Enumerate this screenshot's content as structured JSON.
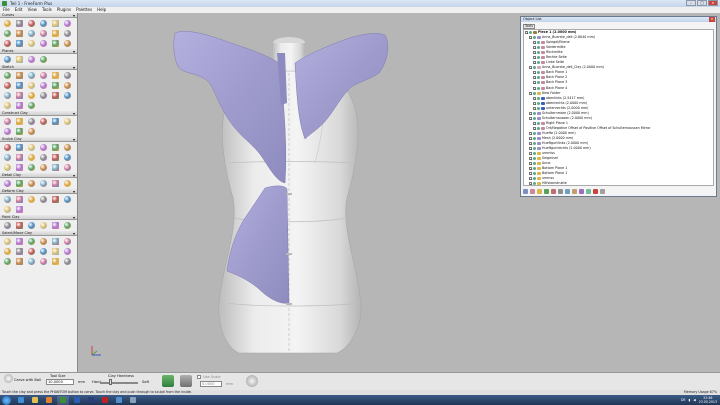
{
  "window": {
    "title": "Teil 1 - FreeForm Plus"
  },
  "menu": [
    "File",
    "Edit",
    "View",
    "Tools",
    "Plugins",
    "Palettes",
    "Help"
  ],
  "palettes": [
    {
      "name": "Curves",
      "icons": [
        "curve-select-icon",
        "curve-draw-icon",
        "curve-sphere-icon",
        "curve-edit-icon",
        "curve-path-icon",
        "curve-wave-icon",
        "curve-point-icon",
        "curve-blob-icon",
        "curve-twist-icon",
        "curve-loop-icon",
        "curve-line-icon",
        "curve-mesh-icon",
        "curve-tool-icon",
        "curve-bend-icon",
        "curve-ring-icon",
        "curve-cut-icon",
        "curve-knot-icon",
        "curve-arrow-icon"
      ]
    },
    {
      "name": "Planes",
      "icons": [
        "plane-icon",
        "plane-offset-icon",
        "plane-angle-icon",
        "plane-grid-icon"
      ]
    },
    {
      "name": "Sketch",
      "icons": [
        "sketch-select-icon",
        "sketch-line-icon",
        "sketch-pen-icon",
        "sketch-pencil-icon",
        "sketch-offset-icon",
        "sketch-mirror-icon",
        "sketch-curve-icon",
        "sketch-fillet-icon",
        "sketch-arc-icon",
        "sketch-trim-icon",
        "sketch-extend-icon",
        "sketch-circle-icon",
        "sketch-rect-icon",
        "sketch-spline-icon",
        "sketch-text-icon",
        "sketch-project-icon",
        "sketch-cut-icon",
        "sketch-grid-icon",
        "sketch-import-icon",
        "sketch-paint-icon",
        "sketch-delete-icon"
      ]
    },
    {
      "name": "Construct Clay",
      "icons": [
        "construct-extrude-icon",
        "construct-revolve-icon",
        "construct-loft-icon",
        "construct-sweep-icon",
        "construct-blob-icon",
        "construct-wrap-icon",
        "construct-box-icon",
        "construct-sphere-icon",
        "construct-cyl-icon"
      ]
    },
    {
      "name": "Sculpt Clay",
      "icons": [
        "sculpt-carve-icon",
        "sculpt-add-icon",
        "sculpt-smooth-icon",
        "sculpt-tug-icon",
        "sculpt-emboss-icon",
        "sculpt-flatten-icon",
        "sculpt-pinch-icon",
        "sculpt-groove-icon",
        "sculpt-stamp-icon",
        "sculpt-mirror-icon",
        "sculpt-fill-icon",
        "sculpt-shrink-icon",
        "sculpt-fillet-icon",
        "sculpt-smudge-icon",
        "sculpt-attract-icon",
        "sculpt-inflate-icon",
        "sculpt-bulge-icon",
        "sculpt-carve2-icon"
      ]
    },
    {
      "name": "Detail Clay",
      "icons": [
        "detail-emboss-icon",
        "detail-carve-icon",
        "detail-engrave-icon",
        "detail-smooth-icon",
        "detail-sharpen-icon",
        "detail-texture-icon"
      ]
    },
    {
      "name": "Deform Clay",
      "icons": [
        "deform-cage-icon",
        "deform-bend-icon",
        "deform-twist-icon",
        "deform-stretch-icon",
        "deform-warp-icon",
        "deform-tug-icon",
        "deform-pin-icon",
        "deform-scale-icon"
      ]
    },
    {
      "name": "Paint Clay",
      "icons": [
        "paint-brush-icon",
        "paint-fill-icon",
        "paint-spray-icon",
        "paint-eraser-icon",
        "paint-stamp-icon",
        "paint-picker-icon"
      ]
    },
    {
      "name": "Select/Move Clay",
      "icons": [
        "select-move-icon",
        "select-rotate-icon",
        "select-scale-icon",
        "select-mirror-icon",
        "select-copy-icon",
        "select-align-icon",
        "select-lasso-icon",
        "select-box-icon",
        "select-paint-icon",
        "select-invert-icon",
        "select-all-icon",
        "select-piece-icon",
        "select-layer-icon",
        "select-group-icon",
        "select-split-icon",
        "select-merge-icon",
        "select-boolean-icon",
        "select-cut-icon"
      ]
    }
  ],
  "object_list": {
    "title": "Object List",
    "tools_label": "Tools",
    "items": [
      {
        "label": "Piece 1 (2.0000 mm)",
        "level": 0,
        "bold": true,
        "color": "#9c7a3b"
      },
      {
        "label": "Anna_Buerste_dell (2.8040 mm)",
        "level": 1,
        "color": "#9b8bcf"
      },
      {
        "label": "Spiegel/Ebene",
        "level": 2,
        "color": "#c58aa0"
      },
      {
        "label": "Vordermitte",
        "level": 2,
        "color": "#c58aa0"
      },
      {
        "label": "Rückmitte",
        "level": 2,
        "color": "#c58aa0"
      },
      {
        "label": "Rechte Seite",
        "level": 2,
        "color": "#c58aa0"
      },
      {
        "label": "Linke Seite",
        "level": 2,
        "color": "#c58aa0"
      },
      {
        "label": "Anna_Buerste_dell_Clay (2.0000 mm)",
        "level": 1,
        "color": "#d3a3b3"
      },
      {
        "label": "Back Plane 1",
        "level": 2,
        "color": "#c58aa0"
      },
      {
        "label": "Back Plane 2",
        "level": 2,
        "color": "#c58aa0"
      },
      {
        "label": "Back Plane 3",
        "level": 2,
        "color": "#c58aa0"
      },
      {
        "label": "Back Plane 4",
        "level": 2,
        "color": "#c58aa0"
      },
      {
        "label": "New Folder",
        "level": 1,
        "color": "#d8b84a"
      },
      {
        "label": "obenlinks (2.5417 mm)",
        "level": 2,
        "color": "#3b5fb8"
      },
      {
        "label": "obenrechts (2.0000 mm)",
        "level": 2,
        "color": "#3b5fb8"
      },
      {
        "label": "untenrechts (2.0000 mm)",
        "level": 2,
        "color": "#3b5fb8"
      },
      {
        "label": "Schulternmam (2.0000 mm)",
        "level": 1,
        "color": "#9b8bcf"
      },
      {
        "label": "Schulternaussen (2.0000 mm)",
        "level": 1,
        "color": "#9b8bcf"
      },
      {
        "label": "Right Plane 1",
        "level": 2,
        "color": "#c58aa0"
      },
      {
        "label": "Ort/Negative Offset of Positive Offset of Schulternaussen Mirror",
        "level": 2,
        "color": "#c58aa0"
      },
      {
        "label": "Huefte (2.0000 mm)",
        "level": 1,
        "color": "#9b8bcf"
      },
      {
        "label": "Mesh (2.0000 mm)",
        "level": 1,
        "color": "#9b8bcf"
      },
      {
        "label": "Hueftgurtlinks (2.0000 mm)",
        "level": 1,
        "color": "#9b8bcf"
      },
      {
        "label": "Hueftgurtrechts (2.0000 mm)",
        "level": 1,
        "color": "#9b8bcf"
      },
      {
        "label": "ummlss",
        "level": 1,
        "color": "#d8b84a"
      },
      {
        "label": "Seigmisel",
        "level": 1,
        "color": "#d8b84a"
      },
      {
        "label": "Anno",
        "level": 1,
        "color": "#d8b84a"
      },
      {
        "label": "Bottom Plane 1",
        "level": 1,
        "color": "#d8b84a"
      },
      {
        "label": "Bottom Plane 1",
        "level": 1,
        "color": "#d8b84a"
      },
      {
        "label": "ummss",
        "level": 1,
        "color": "#d8b84a"
      },
      {
        "label": "Hilfskonstrukte",
        "level": 1,
        "color": "#d8b84a"
      },
      {
        "label": "Naechte Front (2.0000 mm)",
        "level": 1,
        "color": "#9b8bcf"
      }
    ]
  },
  "toolbar": {
    "carve_label": "Carve with Ball",
    "tool_size_label": "Tool Size",
    "tool_size_value": "10.0000",
    "tool_size_unit": "mm",
    "clay_hardness_label": "Clay Hardness",
    "hard_label": "Hard",
    "soft_label": "Soft",
    "clay_hardness_fraction": 0.28,
    "use_scale_label": "Use Scale",
    "scale_value": "0.0000",
    "scale_unit": "mm"
  },
  "status": {
    "message": "Touch the clay and press the PHANTOM button to carve. Touch the clay and push through to sculpt from the inside.",
    "memory": "Memory Usage 67%"
  },
  "taskbar": {
    "time": "22:46",
    "date": "23.05.2013",
    "lang": "DE"
  },
  "colors": {
    "clay": "#9f9ccd",
    "mannequin": "#e6e6e6",
    "viewport_bg": "#b6b6b6"
  }
}
